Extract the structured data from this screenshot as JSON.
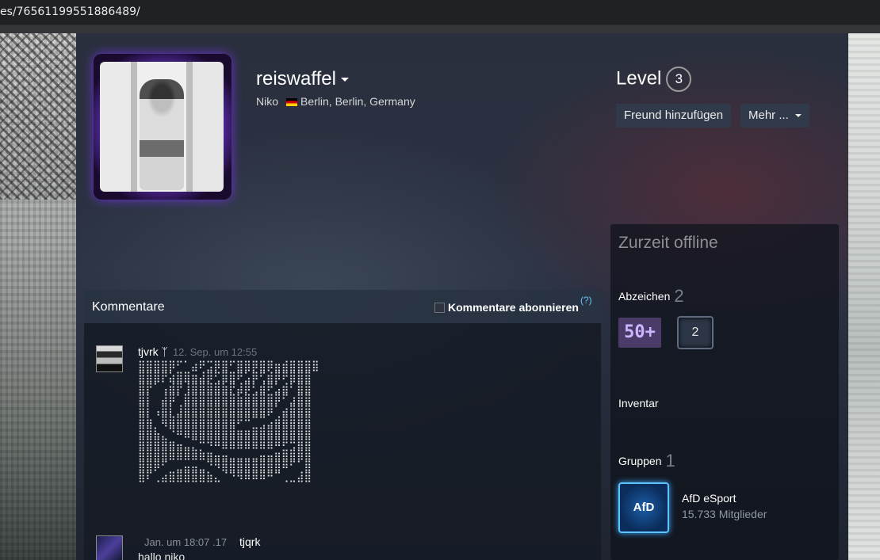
{
  "browser": {
    "url": "es/76561199551886489/"
  },
  "profile": {
    "persona_name": "reiswaffel",
    "real_name": "Niko",
    "location": "Berlin, Berlin, Germany",
    "level_label": "Level",
    "level_value": "3",
    "add_friend_label": "Freund hinzufügen",
    "more_label": "Mehr ..."
  },
  "sidebar": {
    "status": "Zurzeit offline",
    "badges_label": "Abzeichen",
    "badges_count": "2",
    "badge_50_text": "50+",
    "badge_2_text": "2",
    "inventory_label": "Inventar",
    "groups_label": "Gruppen",
    "groups_count": "1",
    "group": {
      "logo_text": "AfD",
      "name": "AfD eSport",
      "members": "15.733 Mitglieder"
    }
  },
  "comments": {
    "title": "Kommentare",
    "subscribe_label": "Kommentare abonnieren",
    "help_label": "(?)",
    "items": [
      {
        "author": "tjvrk ᛉ",
        "time": "12. Sep. um 12:55",
        "art": "⣿⣿⣿⣿⡿⠋⠁⣴⠟⣩⡿⣿⠋⣿⣿⡿⣿⡿⣶⣾⣿⣿⣿⣿\n⣿⣿⣿⡟⣵⣿⣿⣶⣼⡿⢋⣿⣿⠟⣡⡿⢋⣾⡿⠟⣿⣿⣿\n⣿⡟⠁⢠⣾⡟⢸⣿⣿⣿⣿⣷⡟⣼⡿⢃⣾⠟⣡⣾⠃⣿⣿\n⣿⡇⠀⣼⡿⠁⣿⣿⣿⣿⣿⣿⣿⣷⣿⣿⣿⣿⡿⠋⣰⣿⣿\n⣿⡇⢠⣿⡇⣸⣿⣿⣿⣿⣿⣿⣿⣿⣿⣿⣿⡿⠁⣴⣿⣿⣿\n⣿⣷⠀⢿⣿⣿⣿⣿⣿⣿⣿⣿⣿⠟⠛⠉⢉⣠⣾⣿⣿⣿⣿\n⣿⣿⣧⡀⠙⠿⣿⣿⣿⣿⣿⣿⣿⣶⣶⣿⣿⣿⣿⣿⣿⣿⣿\n⣿⣿⣿⣿⣶⣤⣀⡉⠛⠻⠿⣿⣿⣿⣿⣿⣿⣿⠿⠟⢛⣿⣿\n⣿⣿⣿⣿⣿⣿⣿⣿⣷⣶⣤⣤⣀⣀⣀⣀⣤⣤⣶⣿⣿⣿⣿\n⣿⣿⡿⠋⠀⣀⣤⣤⣀⠙⠻⣿⣿⣿⣿⣿⣿⣿⣿⠿⠋⠁⣿\n⣿⠏⢀⣴⣿⣿⣿⣿⣿⣷⣄⠈⠙⠻⠿⠿⠿⠛⠉⢀⣀⣼⣿"
      },
      {
        "author": "tjqrk",
        "time": "Jan. um 18:07 .17",
        "text": "hallo niko"
      }
    ]
  }
}
